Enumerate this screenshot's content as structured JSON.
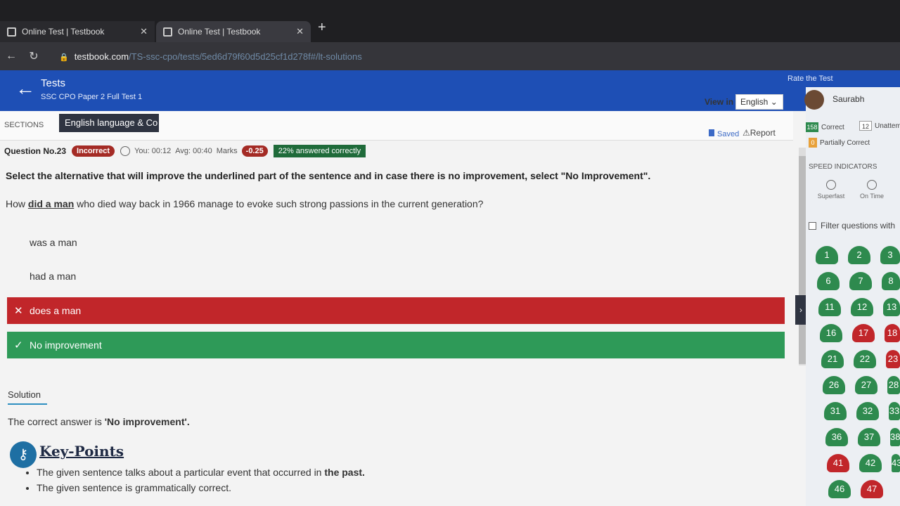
{
  "browser": {
    "tabs": [
      {
        "title": "Online Test | Testbook"
      },
      {
        "title": "Online Test | Testbook"
      }
    ],
    "url_domain": "testbook.com",
    "url_path": "/TS-ssc-cpo/tests/5ed6d79f60d5d25cf1d278f#/lt-solutions"
  },
  "header": {
    "title": "Tests",
    "subtitle": "SSC CPO Paper 2 Full Test 1",
    "rate_link": "Rate the Test"
  },
  "sections": {
    "label": "SECTIONS",
    "active_tab": "English language & Co",
    "view_in_label": "View in",
    "language": "English"
  },
  "question": {
    "number_label": "Question No.23",
    "status": "Incorrect",
    "you_time": "You: 00:12",
    "avg_time": "Avg: 00:40",
    "marks_label": "Marks",
    "marks_value": "-0.25",
    "answered_correctly": "22% answered correctly",
    "saved_label": "Saved",
    "report_label": "Report",
    "direction": "Select the alternative that will improve the underlined part of the sentence and in case there is no improvement, select \"No Improvement\".",
    "text_before": "How ",
    "text_underlined": "did a man",
    "text_after": " who died way back in 1966 manage to evoke such strong passions in the current generation?",
    "options": [
      {
        "label": "was a man"
      },
      {
        "label": "had a man"
      },
      {
        "label": "does a man",
        "mark": "✕"
      },
      {
        "label": "No improvement",
        "mark": "✓"
      }
    ]
  },
  "solution": {
    "tab_label": "Solution",
    "answer_prefix": "The correct answer is ",
    "answer_value": "'No improvement'.",
    "key_points_title": "Key-Points",
    "points": [
      {
        "before": "The given sentence talks about a particular event that occurred in ",
        "bold": "the past."
      },
      {
        "before": "The given sentence is grammatically correct.",
        "bold": ""
      }
    ]
  },
  "sidebar": {
    "user_name": "Saurabh",
    "correct_count": "158",
    "correct_label": "Correct",
    "unattempted_count": "12",
    "unattempted_label": "Unattem",
    "partial_count": "0",
    "partial_label": "Partially Correct",
    "speed_title": "SPEED INDICATORS",
    "speed_items": [
      "Superfast",
      "On Time"
    ],
    "filter_label": "Filter questions with",
    "questions": [
      {
        "n": "1",
        "s": "correct"
      },
      {
        "n": "2",
        "s": "correct"
      },
      {
        "n": "3",
        "s": "correct"
      },
      {
        "n": "6",
        "s": "correct"
      },
      {
        "n": "7",
        "s": "correct"
      },
      {
        "n": "8",
        "s": "correct"
      },
      {
        "n": "11",
        "s": "correct"
      },
      {
        "n": "12",
        "s": "correct"
      },
      {
        "n": "13",
        "s": "correct"
      },
      {
        "n": "16",
        "s": "correct"
      },
      {
        "n": "17",
        "s": "incorrect"
      },
      {
        "n": "18",
        "s": "incorrect"
      },
      {
        "n": "21",
        "s": "correct"
      },
      {
        "n": "22",
        "s": "correct"
      },
      {
        "n": "23",
        "s": "incorrect"
      },
      {
        "n": "26",
        "s": "correct"
      },
      {
        "n": "27",
        "s": "correct"
      },
      {
        "n": "28",
        "s": "correct"
      },
      {
        "n": "31",
        "s": "correct"
      },
      {
        "n": "32",
        "s": "correct"
      },
      {
        "n": "33",
        "s": "correct"
      },
      {
        "n": "36",
        "s": "correct"
      },
      {
        "n": "37",
        "s": "correct"
      },
      {
        "n": "38",
        "s": "correct"
      },
      {
        "n": "41",
        "s": "incorrect"
      },
      {
        "n": "42",
        "s": "correct"
      },
      {
        "n": "43",
        "s": "correct"
      },
      {
        "n": "46",
        "s": "correct"
      },
      {
        "n": "47",
        "s": "incorrect"
      }
    ]
  }
}
